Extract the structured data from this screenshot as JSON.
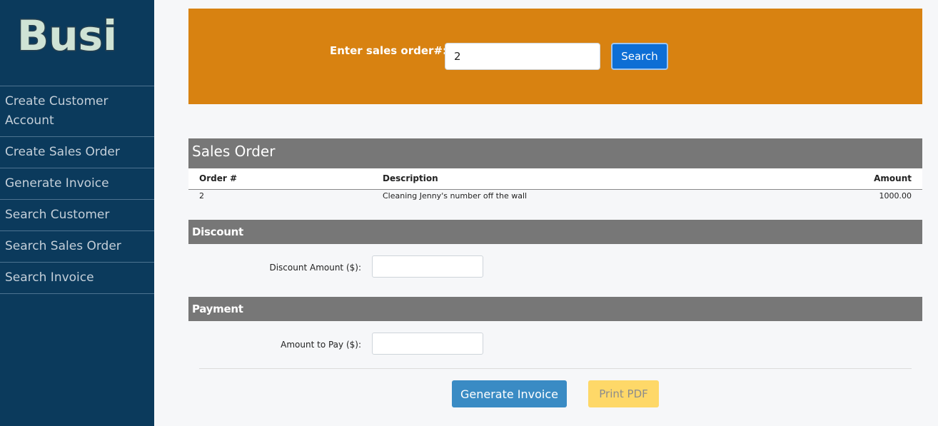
{
  "brand": {
    "logo_text": "Busi"
  },
  "sidebar": {
    "items": [
      {
        "label": "Create Customer Account"
      },
      {
        "label": "Create Sales Order"
      },
      {
        "label": "Generate Invoice"
      },
      {
        "label": "Search Customer"
      },
      {
        "label": "Search Sales Order"
      },
      {
        "label": "Search Invoice"
      }
    ]
  },
  "search": {
    "label": "Enter sales order#:",
    "value": "2",
    "button_label": "Search"
  },
  "sales_order": {
    "title": "Sales Order",
    "columns": [
      "Order #",
      "Description",
      "Amount"
    ],
    "rows": [
      {
        "order": "2",
        "description": "Cleaning Jenny's number off the wall",
        "amount": "1000.00"
      }
    ]
  },
  "discount": {
    "title": "Discount",
    "label": "Discount Amount ($):",
    "value": ""
  },
  "payment": {
    "title": "Payment",
    "label": "Amount to Pay ($):",
    "value": ""
  },
  "actions": {
    "generate_label": "Generate Invoice",
    "print_label": "Print PDF"
  },
  "colors": {
    "sidebar_bg": "#0b3a5c",
    "search_band": "#d88211",
    "section_header": "#777777",
    "primary_button": "#0d6ed5",
    "generate_button": "#3a8bc4",
    "print_button": "#fed868"
  }
}
